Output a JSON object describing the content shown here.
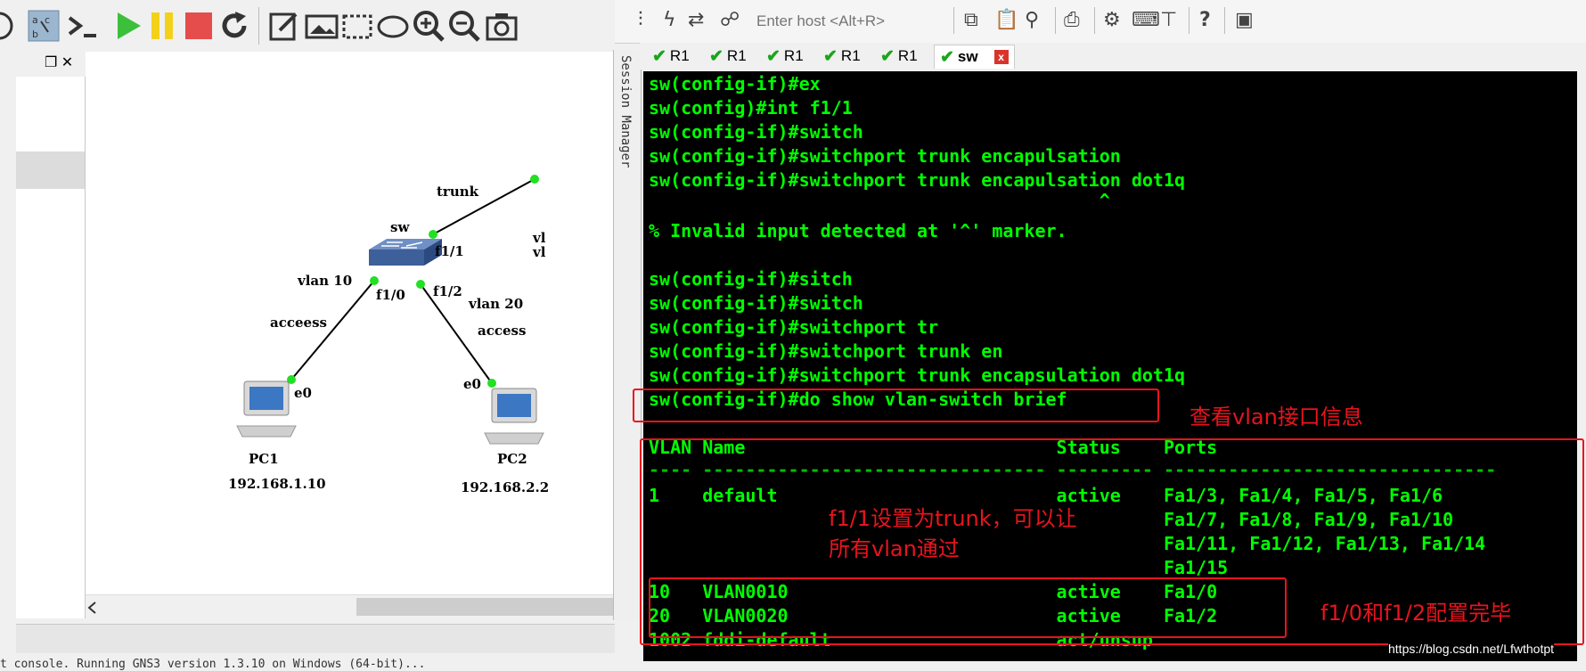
{
  "gns3": {
    "topology": {
      "sw_label": "sw",
      "trunk_label": "trunk",
      "f11_label": "f1/1",
      "f10_label": "f1/0",
      "f12_label": "f1/2",
      "vlan10_label": "vlan 10",
      "vlan20_label": "vlan 20",
      "access1_label": "acceess",
      "access2_label": "access",
      "pc1_port": "e0",
      "pc2_port": "e0",
      "pc1_name": "PC1",
      "pc2_name": "PC2",
      "pc1_ip": "192.168.1.10",
      "pc2_ip": "192.168.2.2",
      "partial_labels": [
        "vl",
        "vl"
      ]
    },
    "panel_controls": "❐ ✕",
    "console_line": "t console. Running GNS3 version 1.3.10 on Windows (64-bit)..."
  },
  "session_manager_label": "Session Manager",
  "securecrt": {
    "host_placeholder": "Enter host <Alt+R>",
    "tabs": [
      {
        "label": "R1",
        "active": false
      },
      {
        "label": "R1",
        "active": false
      },
      {
        "label": "R1",
        "active": false
      },
      {
        "label": "R1",
        "active": false
      },
      {
        "label": "R1",
        "active": false
      },
      {
        "label": "sw",
        "active": true
      }
    ],
    "tab_close": "x",
    "terminal_lines": [
      "sw(config-if)#ex",
      "sw(config)#int f1/1",
      "sw(config-if)#switch",
      "sw(config-if)#switchport trunk encapulsation",
      "sw(config-if)#switchport trunk encapulsation dot1q",
      "                                          ^",
      "% Invalid input detected at '^' marker.",
      "",
      "sw(config-if)#sitch",
      "sw(config-if)#switch",
      "sw(config-if)#switchport tr",
      "sw(config-if)#switchport trunk en",
      "sw(config-if)#switchport trunk encapsulation dot1q",
      "sw(config-if)#do show vlan-switch brief",
      "",
      "VLAN Name                             Status    Ports",
      "---- -------------------------------- --------- -------------------------------",
      "1    default                          active    Fa1/3, Fa1/4, Fa1/5, Fa1/6",
      "                                                Fa1/7, Fa1/8, Fa1/9, Fa1/10",
      "                                                Fa1/11, Fa1/12, Fa1/13, Fa1/14",
      "                                                Fa1/15",
      "10   VLAN0010                         active    Fa1/0",
      "20   VLAN0020                         active    Fa1/2",
      "1002 fddi-default                     act/unsup"
    ],
    "annotations": {
      "view_vlan": "查看vlan接口信息",
      "trunk_note_1": "f1/1设置为trunk，可以让",
      "trunk_note_2": "所有vlan通过",
      "config_done": "f1/0和f1/2配置完毕"
    },
    "watermark": "https://blog.csdn.net/Lfwthotpt"
  },
  "colors": {
    "terminal_bg": "#000000",
    "terminal_fg": "#00ff00",
    "annotation": "#e8141e"
  }
}
